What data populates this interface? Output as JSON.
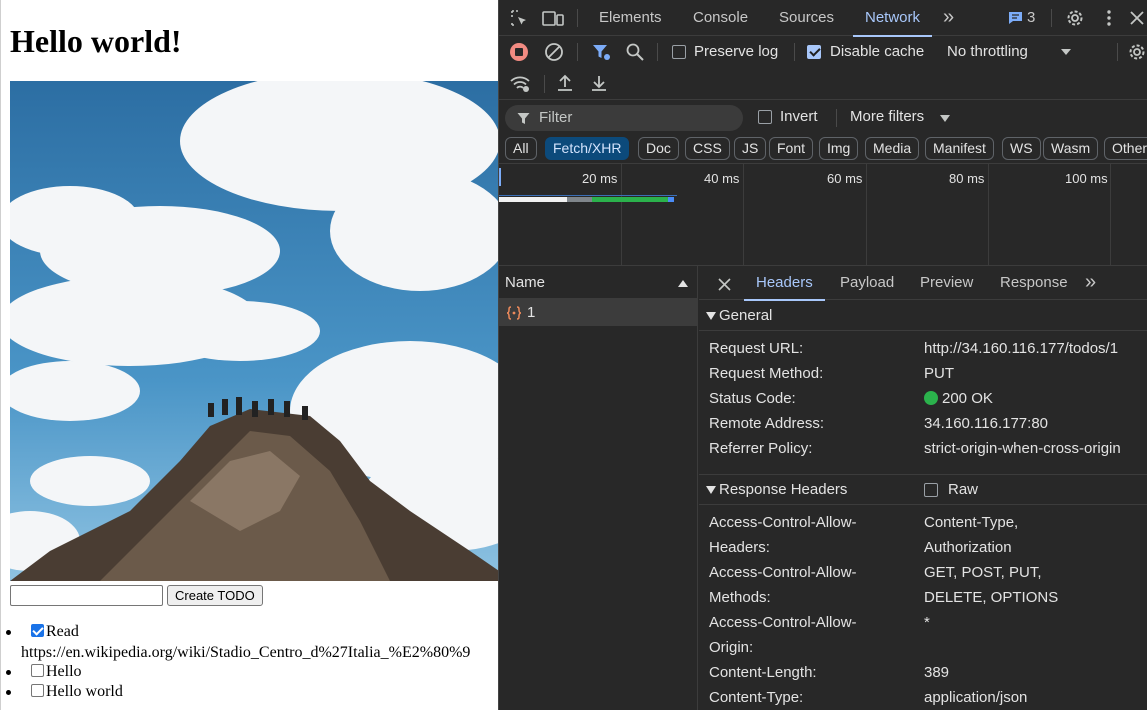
{
  "page": {
    "heading": "Hello world!",
    "todo_input_value": "",
    "create_button_label": "Create TODO",
    "todos": [
      {
        "label": "Read",
        "checked": true,
        "url": "https://en.wikipedia.org/wiki/Stadio_Centro_d%27Italia_%E2%80%9"
      },
      {
        "label": "Hello",
        "checked": false
      },
      {
        "label": "Hello world",
        "checked": false
      }
    ]
  },
  "devtools": {
    "tabs": [
      "Elements",
      "Console",
      "Sources",
      "Network"
    ],
    "active_tab": "Network",
    "more_tabs": "»",
    "issues_count": "3",
    "preserve_log": {
      "label": "Preserve log",
      "checked": false
    },
    "disable_cache": {
      "label": "Disable cache",
      "checked": true
    },
    "throttling": "No throttling",
    "filter_placeholder": "Filter",
    "invert": {
      "label": "Invert",
      "checked": false
    },
    "more_filters": "More filters",
    "type_filters": [
      "All",
      "Fetch/XHR",
      "Doc",
      "CSS",
      "JS",
      "Font",
      "Img",
      "Media",
      "Manifest",
      "WS",
      "Wasm",
      "Other"
    ],
    "active_type_filter": "Fetch/XHR",
    "timeline_ticks": [
      "20 ms",
      "40 ms",
      "60 ms",
      "80 ms",
      "100 ms"
    ],
    "name_column": "Name",
    "requests": [
      {
        "name": "1"
      }
    ],
    "detail_tabs": [
      "Headers",
      "Payload",
      "Preview",
      "Response"
    ],
    "active_detail_tab": "Headers",
    "general": {
      "title": "General",
      "rows": [
        {
          "key": "Request URL:",
          "value": "http://34.160.116.177/todos/1"
        },
        {
          "key": "Request Method:",
          "value": "PUT"
        },
        {
          "key": "Status Code:",
          "value": "200 OK"
        },
        {
          "key": "Remote Address:",
          "value": "34.160.116.177:80"
        },
        {
          "key": "Referrer Policy:",
          "value": "strict-origin-when-cross-origin"
        }
      ]
    },
    "response_headers": {
      "title": "Response Headers",
      "raw_label": "Raw",
      "raw_checked": false,
      "rows": [
        {
          "key_line1": "Access-Control-Allow-",
          "key_line2": "Headers:",
          "value_line1": "Content-Type,",
          "value_line2": "Authorization"
        },
        {
          "key_line1": "Access-Control-Allow-",
          "key_line2": "Methods:",
          "value_line1": "GET, POST, PUT,",
          "value_line2": "DELETE, OPTIONS"
        },
        {
          "key_line1": "Access-Control-Allow-",
          "key_line2": "Origin:",
          "value_line1": "*",
          "value_line2": ""
        },
        {
          "key_line1": "Content-Length:",
          "key_line2": "",
          "value_line1": "389",
          "value_line2": ""
        },
        {
          "key_line1": "Content-Type:",
          "key_line2": "",
          "value_line1": "application/json",
          "value_line2": ""
        }
      ]
    },
    "colors": {
      "accent": "#a8c7fa",
      "status_ok": "#2bb24c",
      "record": "#f28b82",
      "panel_bg": "#282828"
    }
  }
}
